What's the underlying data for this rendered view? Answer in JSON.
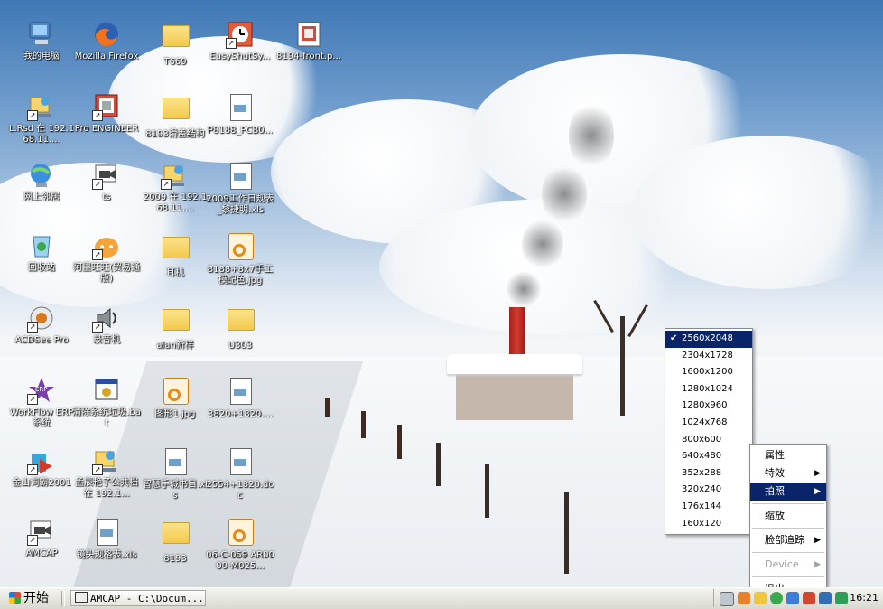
{
  "desktop": {
    "icons": [
      {
        "label": "我的电脑",
        "icon": "computer-icon"
      },
      {
        "label": "Mozilla Firefox",
        "icon": "firefox-icon"
      },
      {
        "label": "T669",
        "icon": "folder-icon"
      },
      {
        "label": "EasyShutSy...",
        "icon": "clock-app-icon"
      },
      {
        "label": "8194-front.p...",
        "icon": "image-file-icon"
      },
      {
        "label": "L.Rsd 在 192.168.11....",
        "icon": "network-share-icon"
      },
      {
        "label": "Pro ENGINEER",
        "icon": "pro-engineer-icon"
      },
      {
        "label": "8193滑盖结构",
        "icon": "folder-icon"
      },
      {
        "label": "P8188_PCB0...",
        "icon": "document-icon"
      },
      {
        "label": "网上邻居",
        "icon": "network-icon"
      },
      {
        "label": "ts",
        "icon": "video-capture-icon"
      },
      {
        "label": "2009 在 192.168.11....",
        "icon": "network-share-icon"
      },
      {
        "label": "2009工作日规表_黎捷明.xls",
        "icon": "document-icon"
      },
      {
        "label": "回收站",
        "icon": "recycle-bin-icon"
      },
      {
        "label": "阿里旺旺(贸易通版)",
        "icon": "aliwangwang-icon"
      },
      {
        "label": "耳机",
        "icon": "folder-icon"
      },
      {
        "label": "8188+8x7手工模配色.jpg",
        "icon": "jpg-file-icon"
      },
      {
        "label": "ACDSee Pro",
        "icon": "acdsee-icon"
      },
      {
        "label": "录音机",
        "icon": "speaker-icon"
      },
      {
        "label": "alan新样",
        "icon": "folder-icon"
      },
      {
        "label": "U303",
        "icon": "folder-icon"
      },
      {
        "label": "WorkFlow ERP 系统",
        "icon": "erp-star-icon"
      },
      {
        "label": "清除系统垃圾.bat",
        "icon": "batch-file-icon"
      },
      {
        "label": "图形1.jpg",
        "icon": "jpg-file-icon"
      },
      {
        "label": "3820+1820....",
        "icon": "document-icon"
      },
      {
        "label": "金山词霸2001",
        "icon": "kingsoft-icon"
      },
      {
        "label": "孟辰艳子公共档 在 192.1...",
        "icon": "network-share-icon"
      },
      {
        "label": "智慧手城书目.xls",
        "icon": "document-icon"
      },
      {
        "label": "2554+1820.doc",
        "icon": "document-icon"
      },
      {
        "label": "AMCAP",
        "icon": "video-capture-icon"
      },
      {
        "label": "镜头规格表.xls",
        "icon": "document-icon"
      },
      {
        "label": "8193",
        "icon": "folder-icon"
      },
      {
        "label": "06-C-059 AR0000-M025...",
        "icon": "jpg-file-icon"
      }
    ]
  },
  "context_menu": {
    "items": [
      {
        "label": "属性",
        "submenu": false,
        "active": false,
        "disabled": false
      },
      {
        "label": "特效",
        "submenu": true,
        "active": false,
        "disabled": false
      },
      {
        "label": "拍照",
        "submenu": true,
        "active": true,
        "disabled": false
      },
      {
        "label": "缩放",
        "submenu": false,
        "active": false,
        "disabled": false
      },
      {
        "label": "脸部追踪",
        "submenu": true,
        "active": false,
        "disabled": false
      },
      {
        "label": "Device",
        "submenu": true,
        "active": false,
        "disabled": true
      },
      {
        "label": "退出",
        "submenu": false,
        "active": false,
        "disabled": false
      }
    ],
    "arrow_glyph": "▶"
  },
  "resolution_menu": {
    "check_glyph": "✔",
    "items": [
      "2560x2048",
      "2304x1728",
      "1600x1200",
      "1280x1024",
      "1280x960",
      "1024x768",
      "800x600",
      "640x480",
      "352x288",
      "320x240",
      "176x144",
      "160x120"
    ],
    "selected": "2560x2048"
  },
  "taskbar": {
    "start_label": "开始",
    "task_label": "AMCAP - C:\\Docum...",
    "clock": "16:21"
  },
  "colors": {
    "menu_highlight": "#0a246a",
    "start_flag": [
      "#e8432f",
      "#37a638",
      "#ffc61a",
      "#1e7be0"
    ]
  }
}
